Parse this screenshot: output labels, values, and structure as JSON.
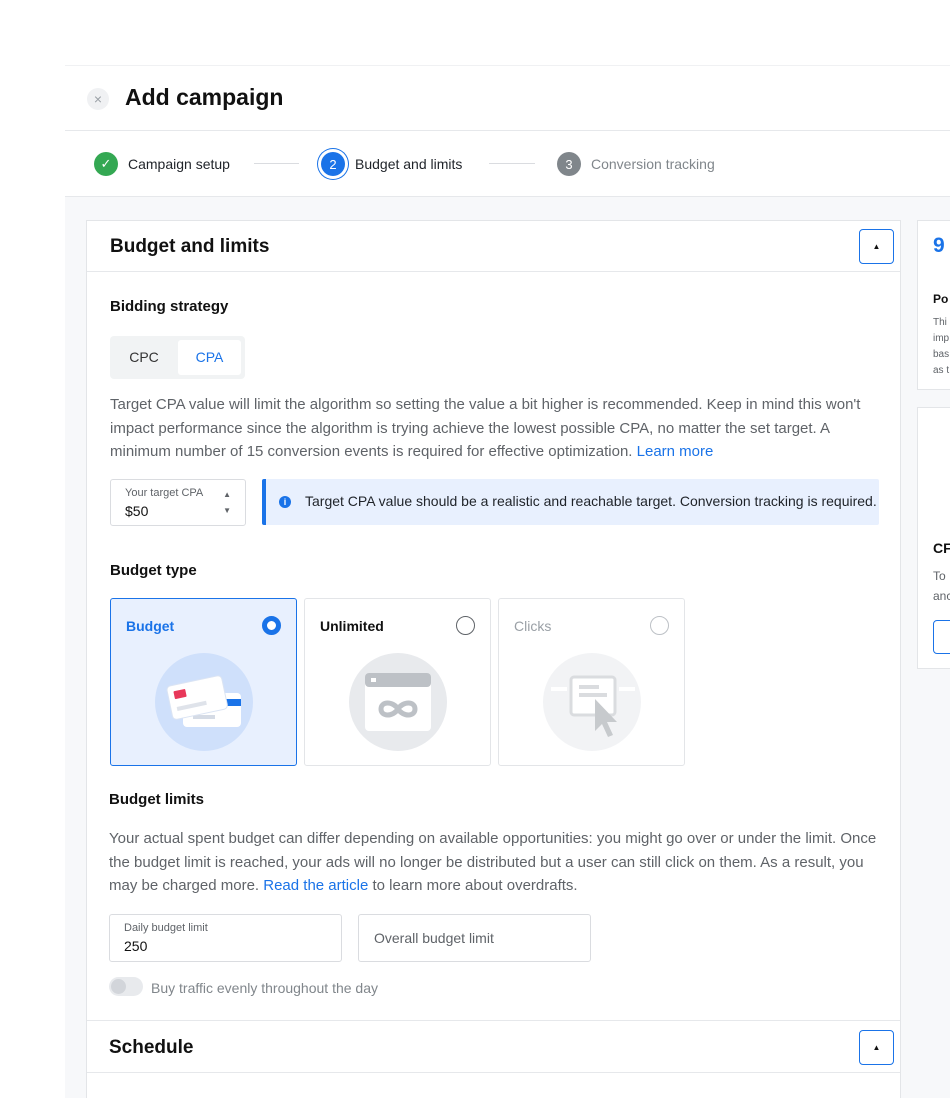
{
  "header": {
    "title": "Add campaign",
    "close_glyph": "×"
  },
  "stepper": {
    "steps": [
      {
        "num": "✓",
        "label": "Campaign setup",
        "state": "done"
      },
      {
        "num": "2",
        "label": "Budget and limits",
        "state": "active"
      },
      {
        "num": "3",
        "label": "Conversion tracking",
        "state": "pending"
      }
    ]
  },
  "budget": {
    "title": "Budget and limits",
    "bidding_label": "Bidding strategy",
    "bidding_options": [
      "CPC",
      "CPA"
    ],
    "bidding_selected": "CPA",
    "desc_text": "Target CPA value will limit the algorithm so setting the value a bit higher is recommended. Keep in mind this won't impact performance since the algorithm is trying achieve the lowest possible CPA, no matter the set target. A minimum number of 15 conversion events is required for effective optimization. ",
    "desc_link": "Learn more",
    "target_cpa_label": "Your target CPA",
    "target_cpa_value": "$50",
    "info_text": "Target CPA value should be a realistic and reachable target. Conversion tracking is required.",
    "budget_type_label": "Budget type",
    "budget_types": [
      {
        "label": "Budget",
        "selected": true,
        "disabled": false
      },
      {
        "label": "Unlimited",
        "selected": false,
        "disabled": false
      },
      {
        "label": "Clicks",
        "selected": false,
        "disabled": true
      }
    ],
    "limits_label": "Budget limits",
    "limits_text_1": "Your actual spent budget can differ depending on available opportunities: you might go over or under the limit. Once the budget limit is reached, your ads will no longer be distributed but a user can still click on them. As a result, you may be charged more. ",
    "limits_link": "Read the article",
    "limits_text_2": " to learn more about overdrafts.",
    "daily_label": "Daily budget limit",
    "daily_value": "250",
    "overall_placeholder": "Overall budget limit",
    "even_label": "Buy traffic evenly throughout the day",
    "even_on": false
  },
  "schedule": {
    "title": "Schedule"
  },
  "side": {
    "card1_value": "9",
    "card1_heading": "Po",
    "card1_lines": [
      "Thi",
      "imp",
      "bas",
      "as t"
    ],
    "card2_heading": "CF",
    "card2_lines": [
      "To",
      "anc"
    ]
  },
  "colors": {
    "accent": "#1a73e8",
    "success": "#34a853",
    "info_bg": "#e8f0fe"
  }
}
